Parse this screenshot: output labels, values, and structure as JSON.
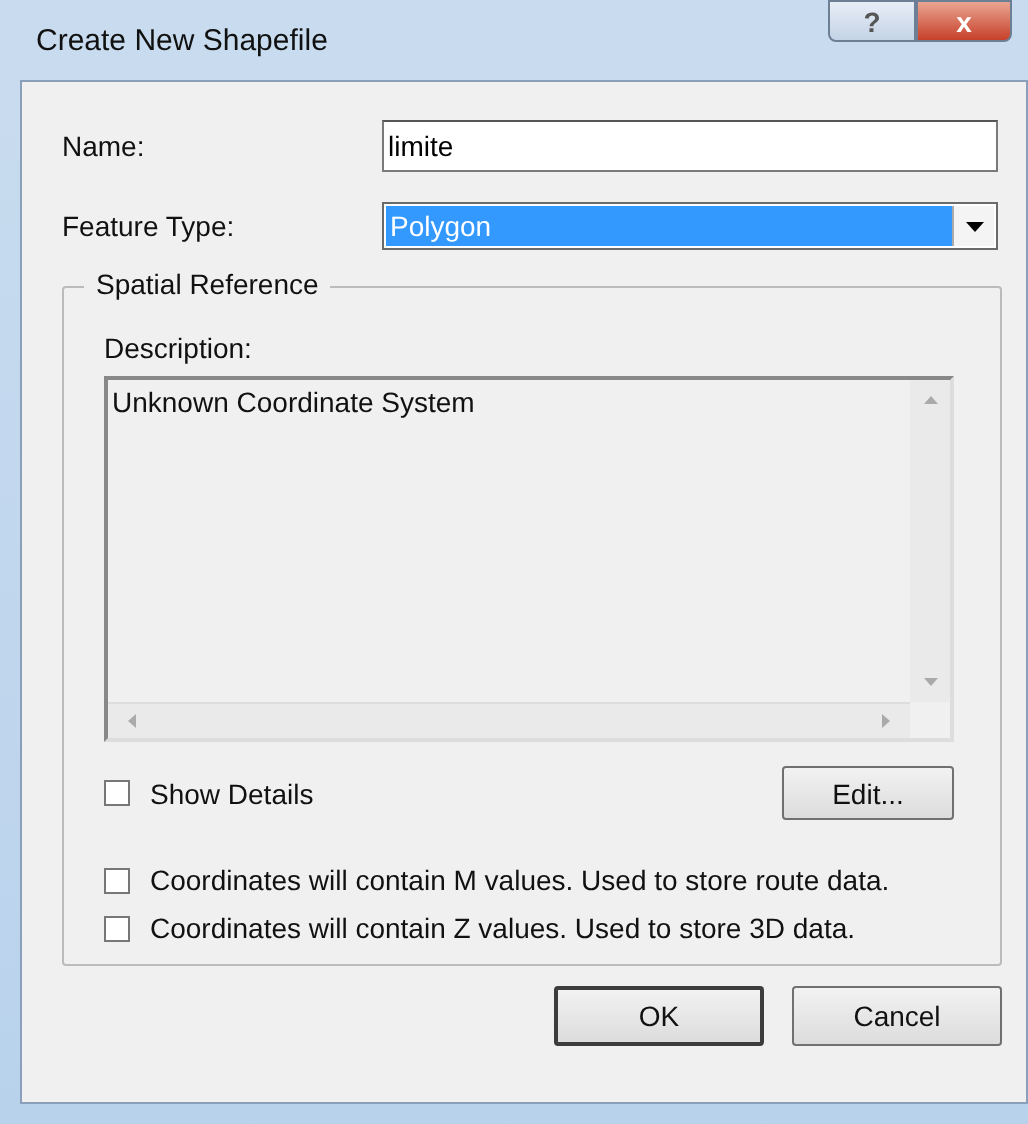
{
  "window": {
    "title": "Create New Shapefile",
    "buttons": [
      {
        "kind": "help",
        "label": "?"
      },
      {
        "kind": "close",
        "label": "x"
      }
    ]
  },
  "name": {
    "label": "Name:",
    "value": "limite"
  },
  "feature_type": {
    "label": "Feature Type:",
    "value": "Polygon",
    "selected": true
  },
  "spatial_reference": {
    "title": "Spatial Reference",
    "description_label": "Description:",
    "description": "Unknown Coordinate System",
    "show_details": {
      "label": "Show Details",
      "checked": false
    },
    "edit_button": "Edit..."
  },
  "options": [
    {
      "label": "Coordinates will contain M values. Used to store route data.",
      "checked": false
    },
    {
      "label": "Coordinates will contain Z values. Used to store 3D data.",
      "checked": false
    }
  ],
  "buttons": [
    {
      "label": "OK",
      "default": true
    },
    {
      "label": "Cancel",
      "default": false
    }
  ]
}
